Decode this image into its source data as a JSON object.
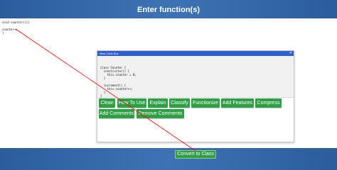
{
  "header": {
    "title": "Enter function(s)"
  },
  "editor": {
    "code": "void counter(){}\n\ncounter++\n}"
  },
  "popup": {
    "title": "New Code Box",
    "close_icon": "✕",
    "code": "class Counter {\n  constructor() {\n    this.counter = 0;\n  }\n\n  increment() {\n    this.counter++;\n  }\n}"
  },
  "actions": {
    "clean": "Clean",
    "how_to_use": "How To Use",
    "explain": "Explain",
    "classify": "Classify",
    "functionize": "Functionize",
    "add_features": "Add Features",
    "compress": "Compress",
    "add_comments": "Add Comments",
    "remove_comments": "Remove Comments"
  },
  "convert_button": "Convert to Class",
  "colors": {
    "background": "#2f63a3",
    "button_green": "#2e9f45",
    "titlebar_blue": "#2d5fd0",
    "annotation_line": "#ff0000"
  },
  "icons": {
    "close": "close-icon"
  }
}
